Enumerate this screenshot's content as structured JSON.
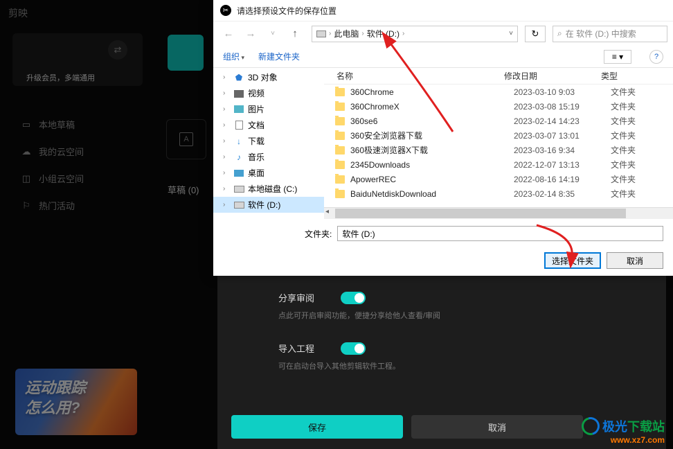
{
  "app": {
    "logo": "剪映",
    "upgrade": "升级会员，多端通用",
    "nav": [
      {
        "icon": "folder",
        "label": "本地草稿"
      },
      {
        "icon": "cloud",
        "label": "我的云空间"
      },
      {
        "icon": "group",
        "label": "小组云空间"
      },
      {
        "icon": "flag",
        "label": "热门活动"
      }
    ],
    "promo_line1": "运动跟踪",
    "promo_line2": "怎么用?",
    "draft_label": "草稿 (0)"
  },
  "settings": {
    "row1_label": "分享审阅",
    "row1_desc": "点此可开启审阅功能，便捷分享给他人查看/审阅",
    "row2_label": "导入工程",
    "row2_desc": "可在启动台导入其他剪辑软件工程。",
    "save": "保存",
    "cancel": "取消"
  },
  "dialog": {
    "title": "请选择预设文件的保存位置",
    "breadcrumb": [
      "此电脑",
      "软件 (D:)"
    ],
    "search_placeholder": "在 软件 (D:) 中搜索",
    "organize": "组织",
    "new_folder": "新建文件夹",
    "tree": [
      {
        "icon": "3d",
        "label": "3D 对象"
      },
      {
        "icon": "vid",
        "label": "视频"
      },
      {
        "icon": "pic",
        "label": "图片"
      },
      {
        "icon": "doc",
        "label": "文档"
      },
      {
        "icon": "dl",
        "label": "下载"
      },
      {
        "icon": "mus",
        "label": "音乐"
      },
      {
        "icon": "desk",
        "label": "桌面"
      },
      {
        "icon": "drv",
        "label": "本地磁盘 (C:)"
      },
      {
        "icon": "drv",
        "label": "软件 (D:)",
        "selected": true
      }
    ],
    "headers": {
      "name": "名称",
      "date": "修改日期",
      "type": "类型"
    },
    "files": [
      {
        "name": "360Chrome",
        "date": "2023-03-10 9:03",
        "type": "文件夹"
      },
      {
        "name": "360ChromeX",
        "date": "2023-03-08 15:19",
        "type": "文件夹"
      },
      {
        "name": "360se6",
        "date": "2023-02-14 14:23",
        "type": "文件夹"
      },
      {
        "name": "360安全浏览器下载",
        "date": "2023-03-07 13:01",
        "type": "文件夹"
      },
      {
        "name": "360极速浏览器X下载",
        "date": "2023-03-16 9:34",
        "type": "文件夹"
      },
      {
        "name": "2345Downloads",
        "date": "2022-12-07 13:13",
        "type": "文件夹"
      },
      {
        "name": "ApowerREC",
        "date": "2022-08-16 14:19",
        "type": "文件夹"
      },
      {
        "name": "BaiduNetdiskDownload",
        "date": "2023-02-14 8:35",
        "type": "文件夹"
      }
    ],
    "folder_label": "文件夹:",
    "folder_value": "软件 (D:)",
    "select_btn": "选择文件夹",
    "cancel_btn": "取消"
  },
  "watermark": {
    "text1": "极光",
    "text2": "下载站",
    "url": "www.xz7.com"
  }
}
